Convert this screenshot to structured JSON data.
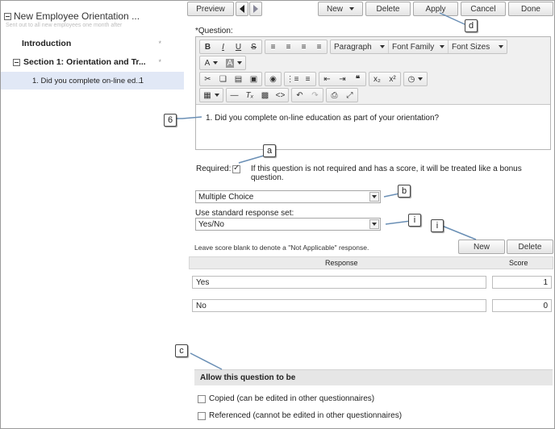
{
  "tree": {
    "title": "New Employee Orientation ...",
    "subtitle": "Sent out to all new employees one month after",
    "items": [
      {
        "label": "Introduction",
        "marker": "*"
      },
      {
        "label": "Section 1: Orientation and Tr...",
        "marker": "*"
      },
      {
        "label": "1. Did you complete on-line ed...",
        "count": "1"
      }
    ]
  },
  "toolbar": {
    "preview": "Preview",
    "new": "New",
    "delete": "Delete",
    "apply": "Apply",
    "cancel": "Cancel",
    "done": "Done"
  },
  "question": {
    "label": "*Question:",
    "text": "1. Did you complete on-line education as part of your orientation?"
  },
  "editor": {
    "paragraph": "Paragraph",
    "font_family": "Font Family",
    "font_sizes": "Font Sizes"
  },
  "required": {
    "label": "Required:",
    "note": "If this question is not required and has a score, it will be treated like a bonus question."
  },
  "type_select": "Multiple Choice",
  "response_set": {
    "label": "Use standard response set:",
    "value": "Yes/No"
  },
  "responses": {
    "hint": "Leave score blank to denote a \"Not Applicable\" response.",
    "new_label": "New",
    "delete_label": "Delete",
    "col_response": "Response",
    "col_score": "Score",
    "rows": [
      {
        "response": "Yes",
        "score": "1"
      },
      {
        "response": "No",
        "score": "0"
      }
    ]
  },
  "allow": {
    "title": "Allow this question to be",
    "copied": "Copied (can be edited in other questionnaires)",
    "referenced": "Referenced (cannot be edited in other questionnaires)"
  },
  "callouts": [
    "a",
    "b",
    "c",
    "d",
    "i",
    "i",
    "6"
  ]
}
